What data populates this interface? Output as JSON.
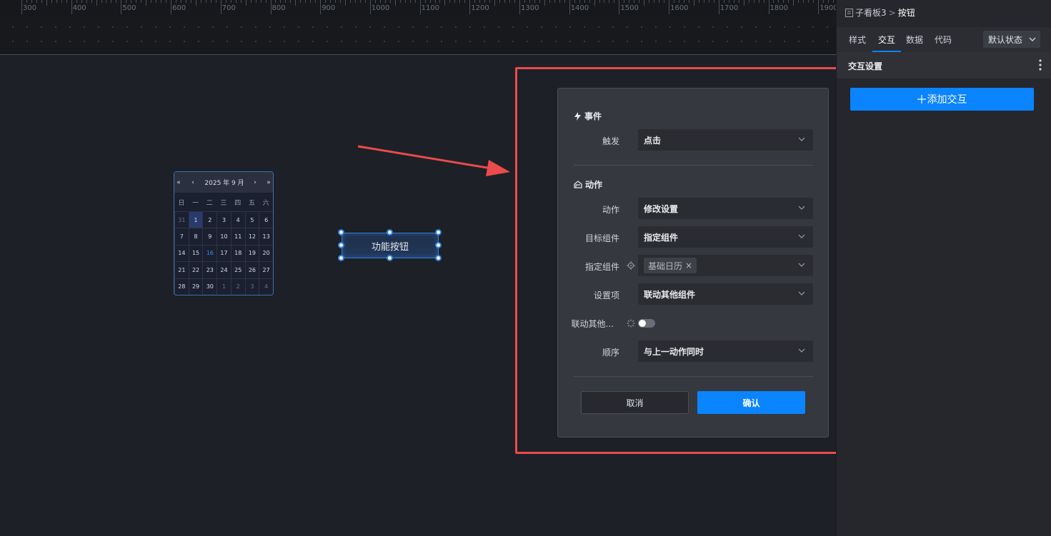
{
  "ruler": {
    "labels": [
      "300",
      "400",
      "500",
      "600",
      "700",
      "800",
      "900",
      "1000",
      "1100",
      "1200",
      "1300",
      "1400",
      "1500",
      "1600",
      "1700",
      "1800",
      "1900"
    ]
  },
  "calendar": {
    "nav_prev_year": "«",
    "nav_prev_month": "‹",
    "month_title": "2025 年 9 月",
    "nav_next_month": "›",
    "nav_next_year": "»",
    "weekdays": [
      "日",
      "一",
      "二",
      "三",
      "四",
      "五",
      "六"
    ],
    "days": [
      {
        "d": "31",
        "muted": true
      },
      {
        "d": "1",
        "sel": true
      },
      {
        "d": "2"
      },
      {
        "d": "3"
      },
      {
        "d": "4"
      },
      {
        "d": "5"
      },
      {
        "d": "6"
      },
      {
        "d": "7"
      },
      {
        "d": "8"
      },
      {
        "d": "9"
      },
      {
        "d": "10"
      },
      {
        "d": "11"
      },
      {
        "d": "12"
      },
      {
        "d": "13"
      },
      {
        "d": "14"
      },
      {
        "d": "15"
      },
      {
        "d": "16",
        "today": true
      },
      {
        "d": "17"
      },
      {
        "d": "18"
      },
      {
        "d": "19"
      },
      {
        "d": "20"
      },
      {
        "d": "21"
      },
      {
        "d": "22"
      },
      {
        "d": "23"
      },
      {
        "d": "24"
      },
      {
        "d": "25"
      },
      {
        "d": "26"
      },
      {
        "d": "27"
      },
      {
        "d": "28"
      },
      {
        "d": "29"
      },
      {
        "d": "30"
      },
      {
        "d": "1",
        "muted": true
      },
      {
        "d": "2",
        "muted": true
      },
      {
        "d": "3",
        "muted": true
      },
      {
        "d": "4",
        "muted": true
      }
    ]
  },
  "canvas_button": {
    "label": "功能按钮"
  },
  "dialog": {
    "event_title": "事件",
    "trigger_label": "触发",
    "trigger_value": "点击",
    "action_title": "动作",
    "action_label": "动作",
    "action_value": "修改设置",
    "target_label": "目标组件",
    "target_value": "指定组件",
    "specified_label": "指定组件",
    "specified_tag": "基础日历",
    "setting_label": "设置项",
    "setting_value": "联动其他组件",
    "link_label": "联动其他...",
    "order_label": "顺序",
    "order_value": "与上一动作同时",
    "cancel": "取消",
    "confirm": "确认"
  },
  "panel": {
    "breadcrumb_parent": "子看板3",
    "breadcrumb_sep": ">",
    "breadcrumb_current": "按钮",
    "tabs": [
      "样式",
      "交互",
      "数据",
      "代码"
    ],
    "active_tab": "交互",
    "state_select": "默认状态",
    "section_title": "交互设置",
    "add_button": "添加交互"
  },
  "colors": {
    "accent": "#0a84ff",
    "highlight": "#ea4b4b",
    "arrow": "#ea4b4b"
  }
}
